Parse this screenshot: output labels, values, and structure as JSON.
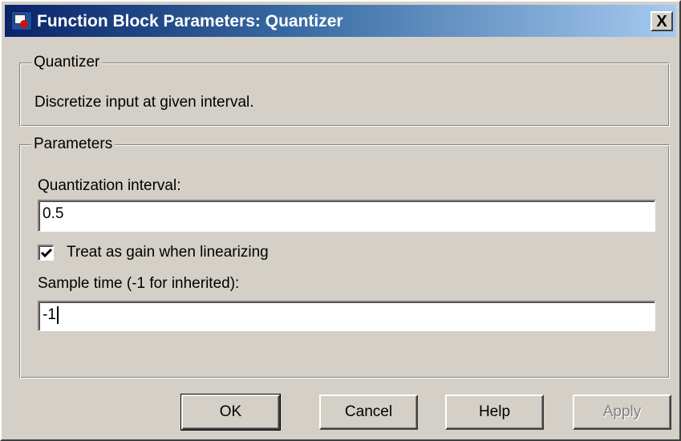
{
  "window": {
    "title": "Function Block Parameters: Quantizer",
    "close_label": "X"
  },
  "block": {
    "group_title": "Quantizer",
    "description": "Discretize input at given interval."
  },
  "parameters": {
    "group_title": "Parameters",
    "quantization_interval": {
      "label": "Quantization interval:",
      "value": "0.5"
    },
    "treat_as_gain": {
      "label": "Treat as gain when linearizing",
      "checked": true
    },
    "sample_time": {
      "label": "Sample time (-1 for inherited):",
      "value": "-1"
    }
  },
  "buttons": {
    "ok": "OK",
    "cancel": "Cancel",
    "help": "Help",
    "apply": "Apply"
  },
  "colors": {
    "title_gradient_start": "#0a246a",
    "title_gradient_end": "#a6caf0",
    "face": "#d4d0c8"
  }
}
